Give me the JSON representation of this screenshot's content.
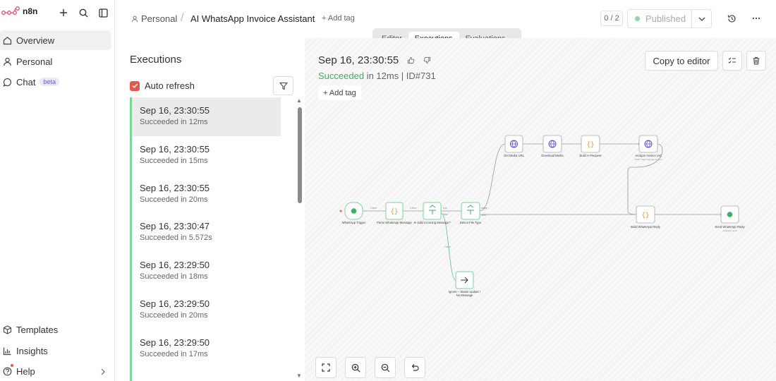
{
  "app": {
    "logo_text": "n8n"
  },
  "sidebar": {
    "items": [
      {
        "label": "Overview",
        "icon": "home-icon"
      },
      {
        "label": "Personal",
        "icon": "user-icon"
      },
      {
        "label": "Chat",
        "icon": "chat-icon",
        "badge": "beta"
      }
    ],
    "bottom_items": [
      {
        "label": "Templates",
        "icon": "box-icon"
      },
      {
        "label": "Insights",
        "icon": "chart-icon"
      },
      {
        "label": "Help",
        "icon": "help-icon"
      }
    ]
  },
  "header": {
    "breadcrumb_project": "Personal",
    "workflow_title": "AI WhatsApp Invoice Assistant",
    "add_tag": "+ Add tag",
    "counter": "0 / 2",
    "publish_status": "Published"
  },
  "tabs": [
    {
      "label": "Editor",
      "active": false
    },
    {
      "label": "Executions",
      "active": true
    },
    {
      "label": "Evaluations",
      "active": false
    }
  ],
  "executions": {
    "title": "Executions",
    "auto_refresh_label": "Auto refresh",
    "auto_refresh_checked": true,
    "items": [
      {
        "date": "Sep 16, 23:30:55",
        "status": "Succeeded in 12ms",
        "selected": true
      },
      {
        "date": "Sep 16, 23:30:55",
        "status": "Succeeded in 15ms",
        "selected": false
      },
      {
        "date": "Sep 16, 23:30:55",
        "status": "Succeeded in 20ms",
        "selected": false
      },
      {
        "date": "Sep 16, 23:30:47",
        "status": "Succeeded in 5.572s",
        "selected": false
      },
      {
        "date": "Sep 16, 23:29:50",
        "status": "Succeeded in 18ms",
        "selected": false
      },
      {
        "date": "Sep 16, 23:29:50",
        "status": "Succeeded in 20ms",
        "selected": false
      },
      {
        "date": "Sep 16, 23:29:50",
        "status": "Succeeded in 17ms",
        "selected": false
      }
    ]
  },
  "run": {
    "date": "Sep 16, 23:30:55",
    "status_word": "Succeeded",
    "status_rest": " in 12ms | ID#731",
    "add_tag": "+ Add tag",
    "copy_button": "Copy to editor"
  },
  "workflow": {
    "nodes": [
      {
        "label": "WhatsApp Trigger",
        "sub": "",
        "icon": "whatsapp-icon"
      },
      {
        "label": "Parse WhatsApp Message",
        "sub": "",
        "icon": "code-icon"
      },
      {
        "label": "Is Valid Incoming Message?",
        "sub": "",
        "icon": "branch-icon"
      },
      {
        "label": "Detect File Type",
        "sub": "",
        "icon": "branch-icon"
      },
      {
        "label": "Get Media URL",
        "sub": "",
        "icon": "globe-icon"
      },
      {
        "label": "Download Media",
        "sub": "",
        "icon": "globe-icon"
      },
      {
        "label": "Build AI Request",
        "sub": "",
        "icon": "code-icon"
      },
      {
        "label": "Analyze Invoice (AI)",
        "sub": "POST: https://api.openai.com",
        "icon": "globe-icon"
      },
      {
        "label": "Build WhatsApp Reply",
        "sub": "",
        "icon": "code-icon"
      },
      {
        "label": "Send WhatsApp Reply",
        "sub": "message: send",
        "icon": "whatsapp-icon"
      },
      {
        "label": "Ignore – Status Update / No Message",
        "sub": "",
        "icon": "arrow-right-icon"
      }
    ],
    "edge_labels": [
      "1 item",
      "1 item",
      "true",
      "false",
      "1 item",
      "image",
      "other"
    ]
  }
}
